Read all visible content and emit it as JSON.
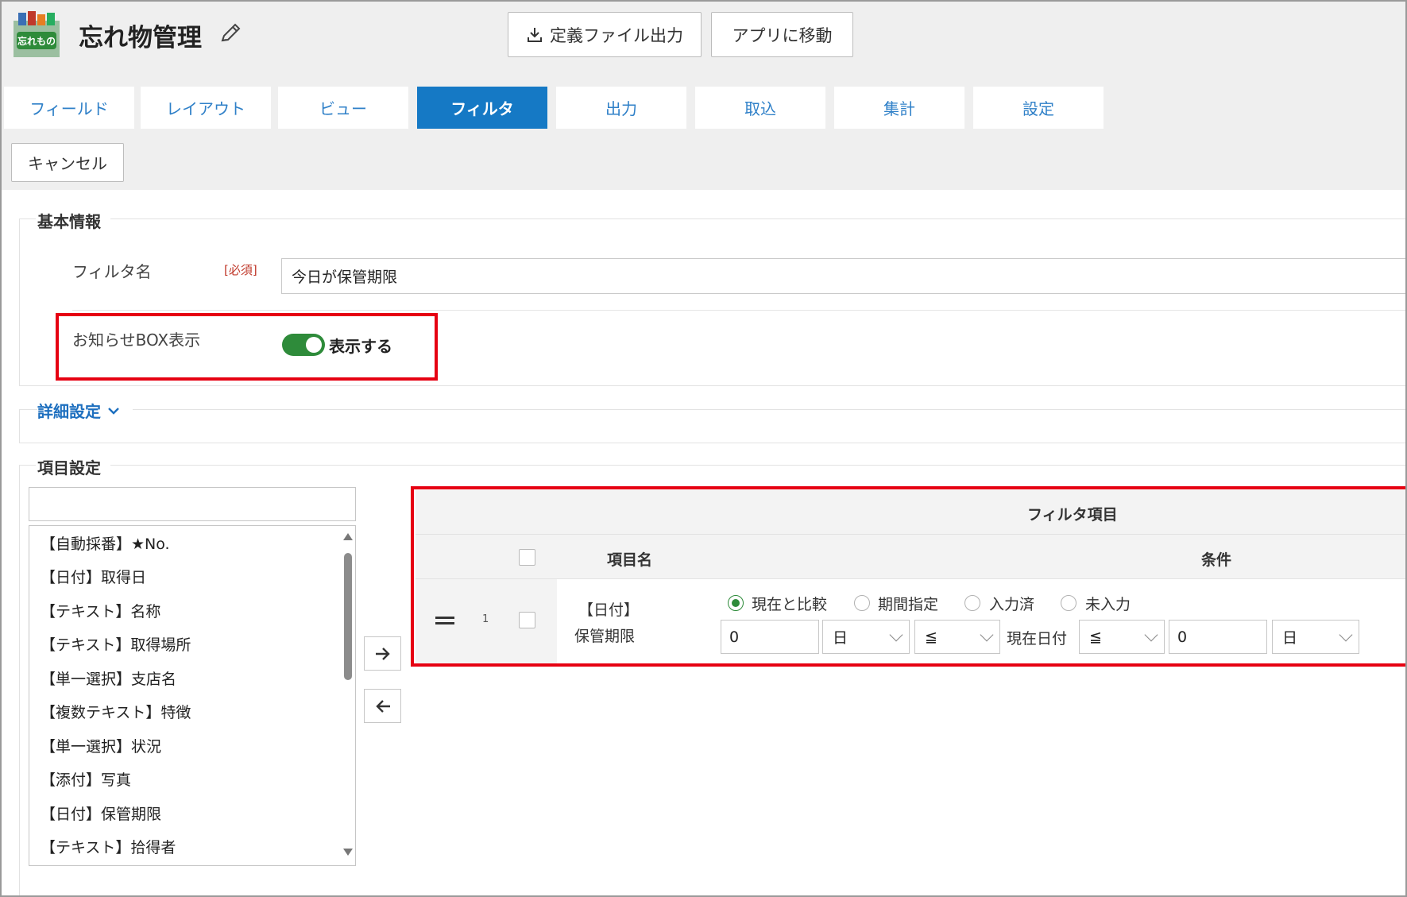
{
  "app": {
    "title": "忘れ物管理",
    "icon_text": "忘れもの"
  },
  "header_buttons": {
    "export": "定義ファイル出力",
    "goto_app": "アプリに移動"
  },
  "tabs": [
    {
      "label": "フィールド",
      "active": false
    },
    {
      "label": "レイアウト",
      "active": false
    },
    {
      "label": "ビュー",
      "active": false
    },
    {
      "label": "フィルタ",
      "active": true
    },
    {
      "label": "出力",
      "active": false
    },
    {
      "label": "取込",
      "active": false
    },
    {
      "label": "集計",
      "active": false
    },
    {
      "label": "設定",
      "active": false
    }
  ],
  "toolbar": {
    "cancel": "キャンセル"
  },
  "basic": {
    "legend": "基本情報",
    "filter_name_label": "フィルタ名",
    "required_badge": "[必須]",
    "filter_name_value": "今日が保管期限",
    "notice_label": "お知らせBOX表示",
    "notice_toggle_on": true,
    "notice_toggle_text": "表示する"
  },
  "detail": {
    "label": "詳細設定"
  },
  "items": {
    "legend": "項目設定",
    "search_value": "",
    "list": [
      "【自動採番】★No.",
      "【日付】取得日",
      "【テキスト】名称",
      "【テキスト】取得場所",
      "【単一選択】支店名",
      "【複数テキスト】特徴",
      "【単一選択】状況",
      "【添付】写真",
      "【日付】保管期限",
      "【テキスト】拾得者"
    ]
  },
  "filter_table": {
    "title": "フィルタ項目",
    "col_name": "項目名",
    "col_condition": "条件",
    "rows": [
      {
        "index": "1",
        "type": "【日付】",
        "name": "保管期限",
        "radio_options": [
          "現在と比較",
          "期間指定",
          "入力済",
          "未入力"
        ],
        "radio_selected": 0,
        "value1": "0",
        "unit1": "日",
        "op1": "≦",
        "middle_text": "現在日付",
        "op2": "≦",
        "value2": "0",
        "unit2": "日"
      }
    ]
  },
  "colors": {
    "accent": "#1579c5",
    "toggle": "#2e8b3a",
    "highlight": "#e60012",
    "link": "#1d6fbf"
  }
}
